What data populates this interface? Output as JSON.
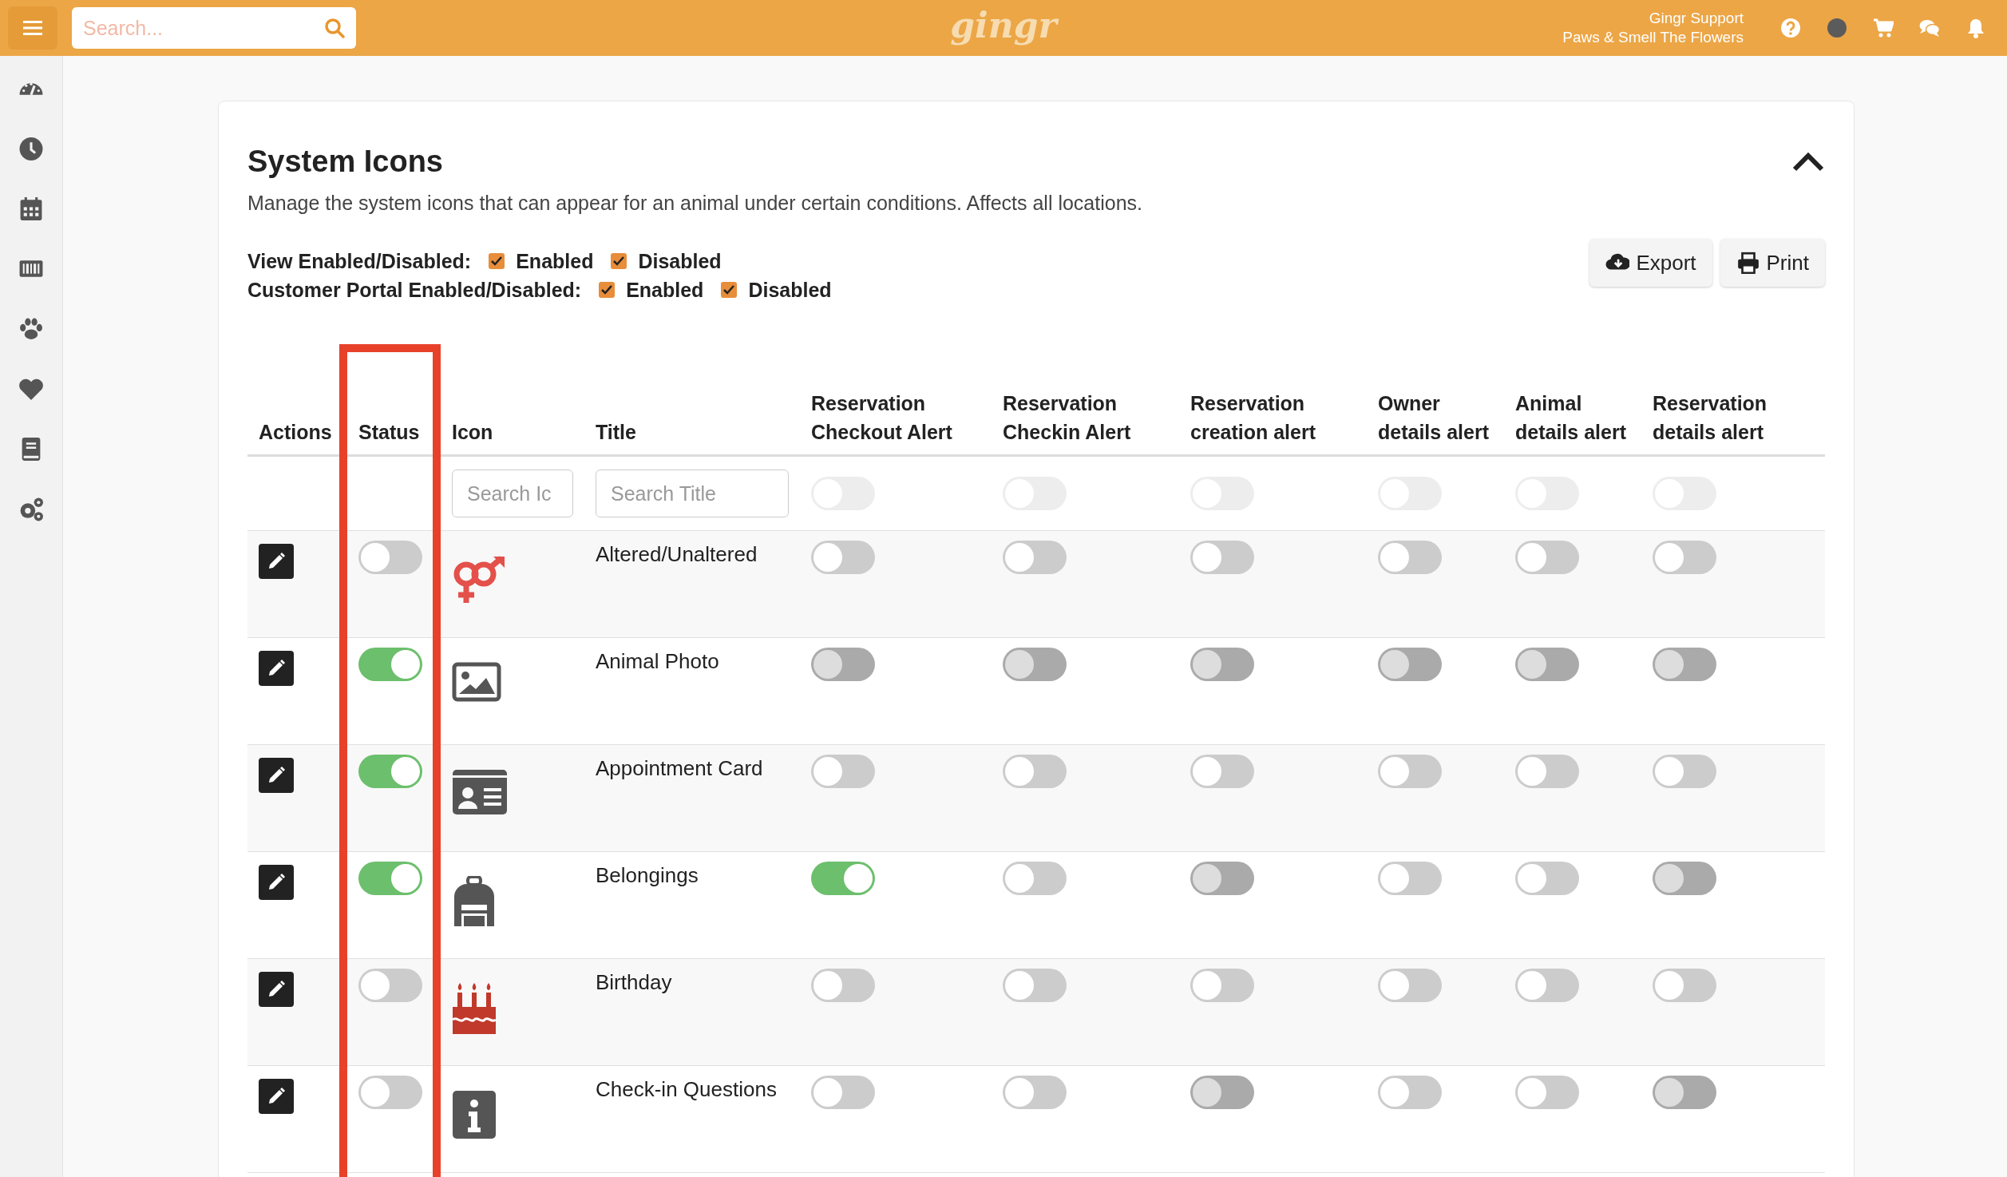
{
  "top_bar": {
    "search": {
      "placeholder": "Search..."
    },
    "logo": "gingr",
    "user": {
      "name": "Gingr Support",
      "location": "Paws & Smell The Flowers"
    }
  },
  "sidebar": {
    "items": [
      {
        "selected": false
      },
      {
        "selected": false
      },
      {
        "selected": false
      },
      {
        "selected": false
      },
      {
        "selected": false
      },
      {
        "selected": false
      },
      {
        "selected": false
      },
      {
        "selected": false
      }
    ]
  },
  "panel": {
    "title": "System Icons",
    "description": "Manage the system icons that can appear for an animal under certain conditions. Affects all locations.",
    "expanded": true,
    "filters": [
      {
        "label": "View Enabled/Disabled:",
        "options": [
          {
            "label": "Enabled",
            "checked": true
          },
          {
            "label": "Disabled",
            "checked": true
          }
        ]
      },
      {
        "label": "Customer Portal Enabled/Disabled:",
        "options": [
          {
            "label": "Enabled",
            "checked": true
          },
          {
            "label": "Disabled",
            "checked": true
          }
        ]
      }
    ],
    "buttons": [
      "Export",
      "Print"
    ]
  },
  "table": {
    "columns": [
      {
        "label": "Actions",
        "highlighted": false
      },
      {
        "label": "Status",
        "highlighted": true
      },
      {
        "label": "Icon",
        "highlighted": false
      },
      {
        "label": "Title",
        "highlighted": false
      },
      {
        "label": "Reservation Checkout Alert",
        "highlighted": false
      },
      {
        "label": "Reservation Checkin Alert",
        "highlighted": false
      },
      {
        "label": "Reservation creation alert",
        "highlighted": false
      },
      {
        "label": "Owner details alert",
        "highlighted": false
      },
      {
        "label": "Animal details alert",
        "highlighted": false
      },
      {
        "label": "Reservation details alert",
        "highlighted": false
      }
    ],
    "filter_row": {
      "icon_search": {
        "placeholder": "Search Ic"
      },
      "title_search": {
        "placeholder": "Search Title"
      },
      "alert_toggles": [
        {
          "on": false
        },
        {
          "on": false
        },
        {
          "on": false
        },
        {
          "on": false
        },
        {
          "on": false
        },
        {
          "on": false
        }
      ]
    },
    "rows": [
      {
        "title": "Altered/Unaltered",
        "status_on": false,
        "alerts": [
          {
            "on": false,
            "locked": false
          },
          {
            "on": false,
            "locked": false
          },
          {
            "on": false,
            "locked": false
          },
          {
            "on": false,
            "locked": false
          },
          {
            "on": false,
            "locked": false
          },
          {
            "on": false,
            "locked": false
          }
        ]
      },
      {
        "title": "Animal Photo",
        "status_on": true,
        "alerts": [
          {
            "on": false,
            "locked": true
          },
          {
            "on": false,
            "locked": true
          },
          {
            "on": false,
            "locked": true
          },
          {
            "on": false,
            "locked": true
          },
          {
            "on": false,
            "locked": true
          },
          {
            "on": false,
            "locked": true
          }
        ]
      },
      {
        "title": "Appointment Card",
        "status_on": true,
        "alerts": [
          {
            "on": false,
            "locked": false
          },
          {
            "on": false,
            "locked": false
          },
          {
            "on": false,
            "locked": false
          },
          {
            "on": false,
            "locked": false
          },
          {
            "on": false,
            "locked": false
          },
          {
            "on": false,
            "locked": false
          }
        ]
      },
      {
        "title": "Belongings",
        "status_on": true,
        "alerts": [
          {
            "on": true,
            "locked": false
          },
          {
            "on": false,
            "locked": false
          },
          {
            "on": false,
            "locked": true
          },
          {
            "on": false,
            "locked": false
          },
          {
            "on": false,
            "locked": false
          },
          {
            "on": false,
            "locked": true
          }
        ]
      },
      {
        "title": "Birthday",
        "status_on": false,
        "alerts": [
          {
            "on": false,
            "locked": false
          },
          {
            "on": false,
            "locked": false
          },
          {
            "on": false,
            "locked": false
          },
          {
            "on": false,
            "locked": false
          },
          {
            "on": false,
            "locked": false
          },
          {
            "on": false,
            "locked": false
          }
        ]
      },
      {
        "title": "Check-in Questions",
        "status_on": false,
        "alerts": [
          {
            "on": false,
            "locked": false
          },
          {
            "on": false,
            "locked": false
          },
          {
            "on": false,
            "locked": true
          },
          {
            "on": false,
            "locked": false
          },
          {
            "on": false,
            "locked": false
          },
          {
            "on": false,
            "locked": true
          }
        ]
      }
    ]
  }
}
